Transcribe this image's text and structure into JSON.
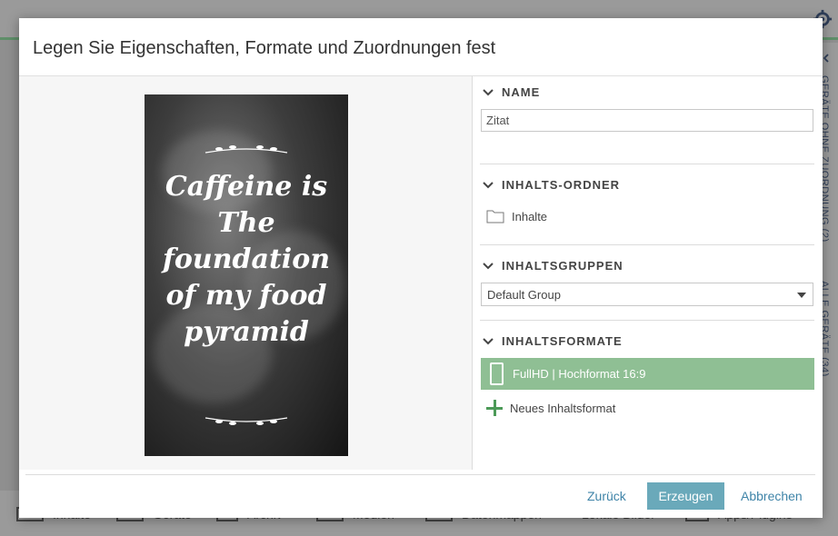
{
  "background": {
    "vertical_tabs": [
      "GERÄTE OHNE ZUORDNUNG (2)",
      "ALLE GERÄTE (34)"
    ],
    "bottom_nav": [
      "Inhalte",
      "Geräte",
      "Archiv",
      "Medien",
      "Datenmappen",
      "Lokale Bilder",
      "Apps/Plugins"
    ]
  },
  "dialog": {
    "title": "Legen Sie Eigenschaften, Formate und Zuordnungen fest",
    "preview": {
      "quote_lines": [
        "Caffeine is",
        "The",
        "foundation",
        "of my food",
        "pyramid"
      ]
    },
    "sections": {
      "name": {
        "header": "NAME",
        "value": "Zitat"
      },
      "folder": {
        "header": "INHALTS-ORDNER",
        "item": "Inhalte"
      },
      "groups": {
        "header": "INHALTSGRUPPEN",
        "selected": "Default Group"
      },
      "formats": {
        "header": "INHALTSFORMATE",
        "item": "FullHD | Hochformat 16:9",
        "add_label": "Neues Inhaltsformat"
      }
    },
    "buttons": {
      "back": "Zurück",
      "create": "Erzeugen",
      "cancel": "Abbrechen"
    }
  },
  "colors": {
    "accent_green": "#8fbf94",
    "primary_button": "#6aa9ba",
    "link": "#3f84a8"
  }
}
